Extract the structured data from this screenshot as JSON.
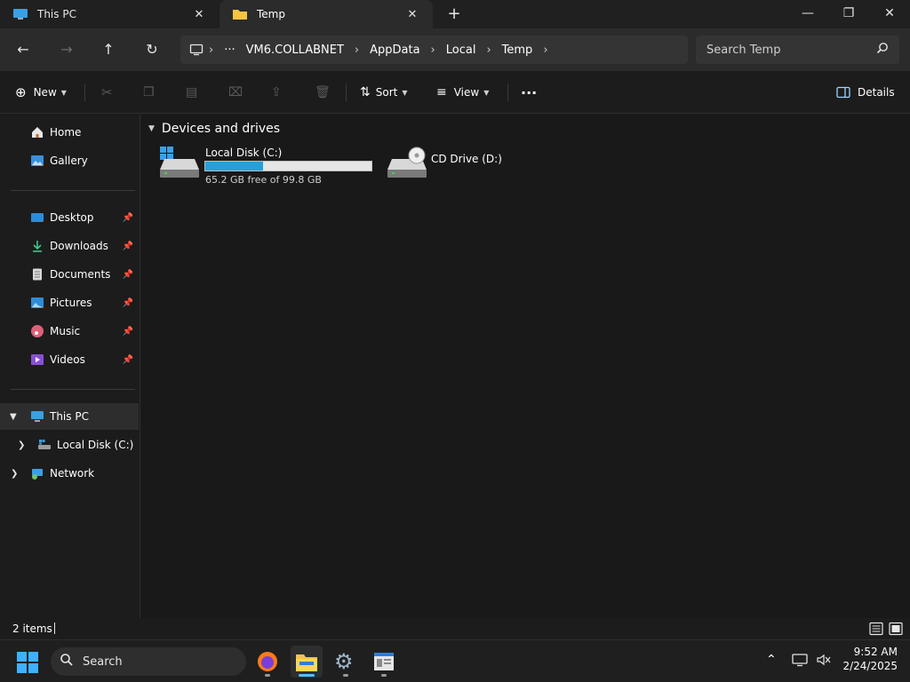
{
  "tabs": [
    {
      "label": "This PC",
      "active": false
    },
    {
      "label": "Temp",
      "active": true
    }
  ],
  "window_controls": {
    "minimize": "—",
    "restore": "❐",
    "close": "✕"
  },
  "address": {
    "breadcrumbs": [
      "VM6.COLLABNET",
      "AppData",
      "Local",
      "Temp"
    ],
    "overflow": "···"
  },
  "search": {
    "placeholder": "Search Temp"
  },
  "commandbar": {
    "new_label": "New",
    "sort_label": "Sort",
    "view_label": "View",
    "more_label": "···",
    "details_label": "Details"
  },
  "navpane": {
    "quick": [
      {
        "label": "Home",
        "icon": "home-icon"
      },
      {
        "label": "Gallery",
        "icon": "gallery-icon"
      }
    ],
    "pinned": [
      {
        "label": "Desktop",
        "icon": "desktop-icon"
      },
      {
        "label": "Downloads",
        "icon": "downloads-icon"
      },
      {
        "label": "Documents",
        "icon": "documents-icon"
      },
      {
        "label": "Pictures",
        "icon": "pictures-icon"
      },
      {
        "label": "Music",
        "icon": "music-icon"
      },
      {
        "label": "Videos",
        "icon": "videos-icon"
      }
    ],
    "tree": [
      {
        "label": "This PC",
        "icon": "this-pc-icon",
        "expanded": true,
        "selected": true
      },
      {
        "label": "Local Disk (C:)",
        "icon": "local-disk-icon",
        "expanded": false
      },
      {
        "label": "Network",
        "icon": "network-icon",
        "expanded": false
      }
    ]
  },
  "content": {
    "group_title": "Devices and drives",
    "drives": [
      {
        "name": "Local Disk (C:)",
        "free_text": "65.2 GB free of 99.8 GB",
        "used_fraction": 0.347
      },
      {
        "name": "CD Drive (D:)"
      }
    ]
  },
  "status": {
    "items_count": "2 items"
  },
  "taskbar": {
    "search_label": "Search",
    "time": "9:52 AM",
    "date": "2/24/2025"
  },
  "colors": {
    "accent": "#4cc2ff",
    "drive_bar_fill": "#26a0da",
    "background": "#191919"
  }
}
